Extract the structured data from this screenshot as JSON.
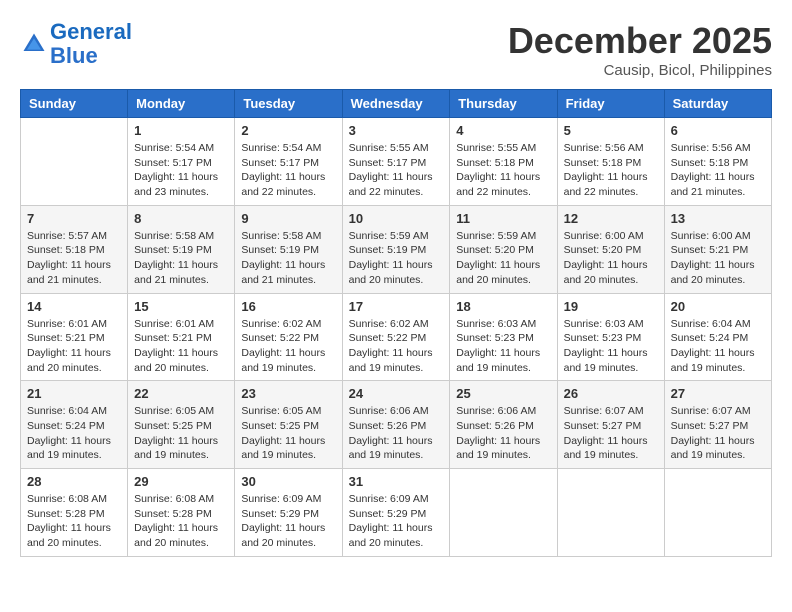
{
  "logo": {
    "line1": "General",
    "line2": "Blue"
  },
  "title": "December 2025",
  "subtitle": "Causip, Bicol, Philippines",
  "header": {
    "days": [
      "Sunday",
      "Monday",
      "Tuesday",
      "Wednesday",
      "Thursday",
      "Friday",
      "Saturday"
    ]
  },
  "weeks": [
    {
      "cells": [
        {
          "day": "",
          "info": ""
        },
        {
          "day": "1",
          "info": "Sunrise: 5:54 AM\nSunset: 5:17 PM\nDaylight: 11 hours\nand 23 minutes."
        },
        {
          "day": "2",
          "info": "Sunrise: 5:54 AM\nSunset: 5:17 PM\nDaylight: 11 hours\nand 22 minutes."
        },
        {
          "day": "3",
          "info": "Sunrise: 5:55 AM\nSunset: 5:17 PM\nDaylight: 11 hours\nand 22 minutes."
        },
        {
          "day": "4",
          "info": "Sunrise: 5:55 AM\nSunset: 5:18 PM\nDaylight: 11 hours\nand 22 minutes."
        },
        {
          "day": "5",
          "info": "Sunrise: 5:56 AM\nSunset: 5:18 PM\nDaylight: 11 hours\nand 22 minutes."
        },
        {
          "day": "6",
          "info": "Sunrise: 5:56 AM\nSunset: 5:18 PM\nDaylight: 11 hours\nand 21 minutes."
        }
      ]
    },
    {
      "cells": [
        {
          "day": "7",
          "info": "Sunrise: 5:57 AM\nSunset: 5:18 PM\nDaylight: 11 hours\nand 21 minutes."
        },
        {
          "day": "8",
          "info": "Sunrise: 5:58 AM\nSunset: 5:19 PM\nDaylight: 11 hours\nand 21 minutes."
        },
        {
          "day": "9",
          "info": "Sunrise: 5:58 AM\nSunset: 5:19 PM\nDaylight: 11 hours\nand 21 minutes."
        },
        {
          "day": "10",
          "info": "Sunrise: 5:59 AM\nSunset: 5:19 PM\nDaylight: 11 hours\nand 20 minutes."
        },
        {
          "day": "11",
          "info": "Sunrise: 5:59 AM\nSunset: 5:20 PM\nDaylight: 11 hours\nand 20 minutes."
        },
        {
          "day": "12",
          "info": "Sunrise: 6:00 AM\nSunset: 5:20 PM\nDaylight: 11 hours\nand 20 minutes."
        },
        {
          "day": "13",
          "info": "Sunrise: 6:00 AM\nSunset: 5:21 PM\nDaylight: 11 hours\nand 20 minutes."
        }
      ]
    },
    {
      "cells": [
        {
          "day": "14",
          "info": "Sunrise: 6:01 AM\nSunset: 5:21 PM\nDaylight: 11 hours\nand 20 minutes."
        },
        {
          "day": "15",
          "info": "Sunrise: 6:01 AM\nSunset: 5:21 PM\nDaylight: 11 hours\nand 20 minutes."
        },
        {
          "day": "16",
          "info": "Sunrise: 6:02 AM\nSunset: 5:22 PM\nDaylight: 11 hours\nand 19 minutes."
        },
        {
          "day": "17",
          "info": "Sunrise: 6:02 AM\nSunset: 5:22 PM\nDaylight: 11 hours\nand 19 minutes."
        },
        {
          "day": "18",
          "info": "Sunrise: 6:03 AM\nSunset: 5:23 PM\nDaylight: 11 hours\nand 19 minutes."
        },
        {
          "day": "19",
          "info": "Sunrise: 6:03 AM\nSunset: 5:23 PM\nDaylight: 11 hours\nand 19 minutes."
        },
        {
          "day": "20",
          "info": "Sunrise: 6:04 AM\nSunset: 5:24 PM\nDaylight: 11 hours\nand 19 minutes."
        }
      ]
    },
    {
      "cells": [
        {
          "day": "21",
          "info": "Sunrise: 6:04 AM\nSunset: 5:24 PM\nDaylight: 11 hours\nand 19 minutes."
        },
        {
          "day": "22",
          "info": "Sunrise: 6:05 AM\nSunset: 5:25 PM\nDaylight: 11 hours\nand 19 minutes."
        },
        {
          "day": "23",
          "info": "Sunrise: 6:05 AM\nSunset: 5:25 PM\nDaylight: 11 hours\nand 19 minutes."
        },
        {
          "day": "24",
          "info": "Sunrise: 6:06 AM\nSunset: 5:26 PM\nDaylight: 11 hours\nand 19 minutes."
        },
        {
          "day": "25",
          "info": "Sunrise: 6:06 AM\nSunset: 5:26 PM\nDaylight: 11 hours\nand 19 minutes."
        },
        {
          "day": "26",
          "info": "Sunrise: 6:07 AM\nSunset: 5:27 PM\nDaylight: 11 hours\nand 19 minutes."
        },
        {
          "day": "27",
          "info": "Sunrise: 6:07 AM\nSunset: 5:27 PM\nDaylight: 11 hours\nand 19 minutes."
        }
      ]
    },
    {
      "cells": [
        {
          "day": "28",
          "info": "Sunrise: 6:08 AM\nSunset: 5:28 PM\nDaylight: 11 hours\nand 20 minutes."
        },
        {
          "day": "29",
          "info": "Sunrise: 6:08 AM\nSunset: 5:28 PM\nDaylight: 11 hours\nand 20 minutes."
        },
        {
          "day": "30",
          "info": "Sunrise: 6:09 AM\nSunset: 5:29 PM\nDaylight: 11 hours\nand 20 minutes."
        },
        {
          "day": "31",
          "info": "Sunrise: 6:09 AM\nSunset: 5:29 PM\nDaylight: 11 hours\nand 20 minutes."
        },
        {
          "day": "",
          "info": ""
        },
        {
          "day": "",
          "info": ""
        },
        {
          "day": "",
          "info": ""
        }
      ]
    }
  ]
}
